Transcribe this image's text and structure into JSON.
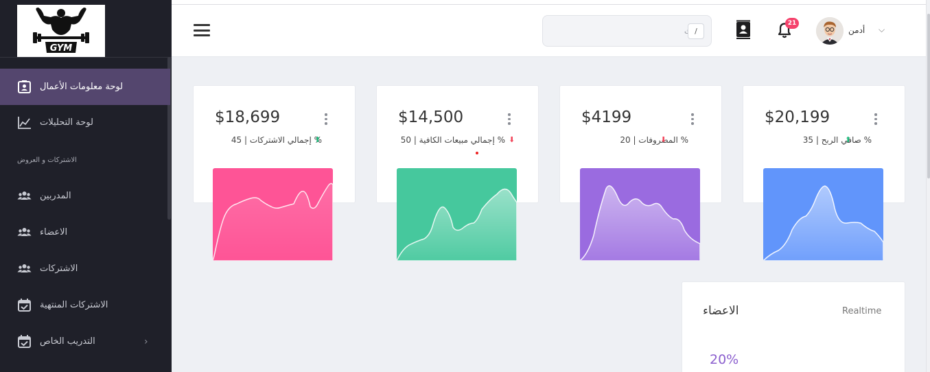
{
  "header": {
    "search_placeholder": "بحث",
    "search_shortcut": "/",
    "notifications_count": "21",
    "user_name": "أدمن"
  },
  "sidebar": {
    "logo_text": "GYM",
    "items": [
      {
        "label": "لوحة معلومات الأعمال",
        "icon": "contact-card-icon",
        "active": true
      },
      {
        "label": "لوحة التحليلات",
        "icon": "line-chart-icon"
      },
      {
        "label": "المدربين",
        "icon": "users-icon"
      },
      {
        "label": "الاعضاء",
        "icon": "users-icon"
      },
      {
        "label": "الاشتركات",
        "icon": "users-icon"
      },
      {
        "label": "الاشتركات المنتهية",
        "icon": "calendar-check-icon"
      },
      {
        "label": "التدريب الخاص",
        "icon": "calendar-check-icon"
      }
    ],
    "section_heading": "الاشتركات و العروض"
  },
  "cards": [
    {
      "amount": "$18,699",
      "label": "%  إجمالي الاشتركات | 45",
      "trend": "up",
      "color": "#fe5496"
    },
    {
      "amount": "$14,500",
      "label": "%  إجمالي مبيعات الكافية | 50",
      "trend": "down",
      "color": "#46c89d"
    },
    {
      "amount": "$4199",
      "label": "%  المصروفات | 20",
      "trend": "down",
      "color": "#9a6be0"
    },
    {
      "amount": "$20,199",
      "label": "%  صافي الربح | 35",
      "trend": "up",
      "color": "#6195fb"
    }
  ],
  "members_card": {
    "title": "الاعضاء",
    "realtime": "Realtime",
    "percent": "20%"
  },
  "colors": {
    "sidebar_bg": "#1f2029",
    "active_item_bg": "#54466e",
    "trend_up": "#1cb97a",
    "trend_down": "#f2455a",
    "badge": "#f5426c"
  }
}
